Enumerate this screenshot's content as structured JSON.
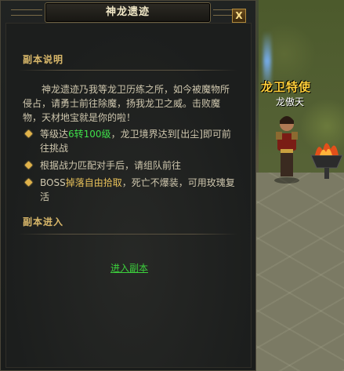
{
  "dialog": {
    "title": "神龙遗迹",
    "close_label": "X",
    "intro_section_title": "副本说明",
    "description": "神龙遗迹乃我等龙卫历练之所，如今被魔物所侵占，请勇士前往除魔，扬我龙卫之威。击败魔物，天材地宝就是你的啦！",
    "bullets": [
      {
        "pre": "等级达",
        "highlight": "6转100级",
        "post": "，龙卫境界达到[出尘]即可前往挑战"
      },
      {
        "pre": "根据战力匹配对手后，请组队前往",
        "highlight": "",
        "post": ""
      },
      {
        "pre": "BOSS",
        "highlight": "掉落自由拾取",
        "post": "，死亡不爆装，可用玫瑰复活"
      }
    ],
    "enter_section_title": "副本进入",
    "enter_link_label": "进入副本"
  },
  "scene": {
    "npc_title": "龙卫特使",
    "npc_name": "龙傲天"
  },
  "colors": {
    "section_title": "#d9b86a",
    "highlight_green": "#3fe04a",
    "highlight_gold": "#e8c15a",
    "npc_title": "#ffd03a"
  }
}
